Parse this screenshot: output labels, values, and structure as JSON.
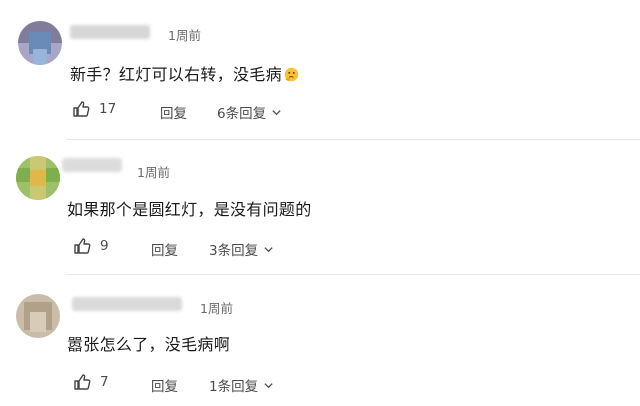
{
  "comments": [
    {
      "time": "1周前",
      "text": "新手？红灯可以右转，没毛病",
      "emoji_icon": "thinking-face-emoji",
      "likes": "17",
      "reply_label": "回复",
      "replies_label": "6条回复"
    },
    {
      "time": "1周前",
      "text": "如果那个是圆红灯，是没有问题的",
      "likes": "9",
      "reply_label": "回复",
      "replies_label": "3条回复"
    },
    {
      "time": "1周前",
      "text": "嚣张怎么了，没毛病啊",
      "likes": "7",
      "reply_label": "回复",
      "replies_label": "1条回复"
    }
  ],
  "colors": {
    "text": "#1a1a1a",
    "meta": "#6b6b6b",
    "divider": "#e6e6e6"
  }
}
